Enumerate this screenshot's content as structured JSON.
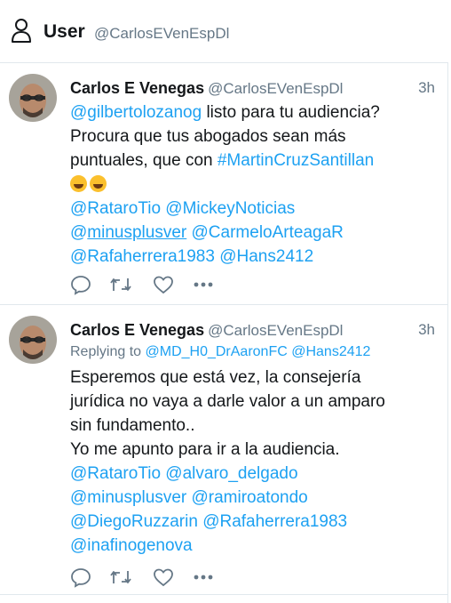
{
  "header": {
    "icon": "user-icon",
    "title": "User",
    "handle": "@CarlosEVenEspDl"
  },
  "tweets": [
    {
      "author": "Carlos E Venegas",
      "handle": "@CarlosEVenEspDl",
      "time": "3h",
      "lines": [
        [
          {
            "t": "@gilbertolozanog",
            "k": "link"
          },
          {
            "t": " listo para tu audiencia?",
            "k": "text"
          }
        ],
        [
          {
            "t": "Procura que tus abogados sean más",
            "k": "text"
          }
        ],
        [
          {
            "t": "puntuales, que con  ",
            "k": "text"
          },
          {
            "t": "#MartinCruzSantillan",
            "k": "link"
          }
        ],
        [
          {
            "t": "rolling-laughing-emoji",
            "k": "emoji"
          },
          {
            "t": "grinning-sweat-emoji",
            "k": "emoji"
          }
        ],
        [
          {
            "t": "@RataroTio",
            "k": "link"
          },
          {
            "t": " ",
            "k": "text"
          },
          {
            "t": "@MickeyNoticias",
            "k": "link"
          }
        ],
        [
          {
            "t": "@",
            "k": "link"
          },
          {
            "t": "minusplusver",
            "k": "link-u"
          },
          {
            "t": " ",
            "k": "text"
          },
          {
            "t": "@CarmeloArteagaR",
            "k": "link"
          }
        ],
        [
          {
            "t": " ",
            "k": "text"
          },
          {
            "t": "@Rafaherrera1983",
            "k": "link"
          },
          {
            "t": " ",
            "k": "text"
          },
          {
            "t": "@Hans2412",
            "k": "link"
          }
        ]
      ]
    },
    {
      "author": "Carlos E Venegas",
      "handle": "@CarlosEVenEspDl",
      "time": "3h",
      "replying": {
        "label": "Replying to",
        "users": [
          "@MD_H0_DrAaronFC",
          "@Hans2412"
        ]
      },
      "lines": [
        [
          {
            "t": "Esperemos que está vez, la consejería",
            "k": "text"
          }
        ],
        [
          {
            "t": "jurídica no vaya a darle valor a un amparo",
            "k": "text"
          }
        ],
        [
          {
            "t": "sin fundamento..",
            "k": "text"
          }
        ],
        [
          {
            "t": "Yo me apunto para ir a la audiencia.",
            "k": "text"
          }
        ],
        [
          {
            "t": "@RataroTio",
            "k": "link"
          },
          {
            "t": " ",
            "k": "text"
          },
          {
            "t": "@alvaro_delgado",
            "k": "link"
          }
        ],
        [
          {
            "t": "@minusplusver",
            "k": "link"
          },
          {
            "t": " ",
            "k": "text"
          },
          {
            "t": "@ramiroatondo",
            "k": "link"
          }
        ],
        [
          {
            "t": "@DiegoRuzzarin",
            "k": "link"
          },
          {
            "t": " ",
            "k": "text"
          },
          {
            "t": "@Rafaherrera1983",
            "k": "link"
          }
        ],
        [
          {
            "t": "@inafinogenova",
            "k": "link"
          }
        ]
      ]
    }
  ],
  "actions": [
    "reply-icon",
    "retweet-icon",
    "like-icon",
    "more-icon"
  ]
}
